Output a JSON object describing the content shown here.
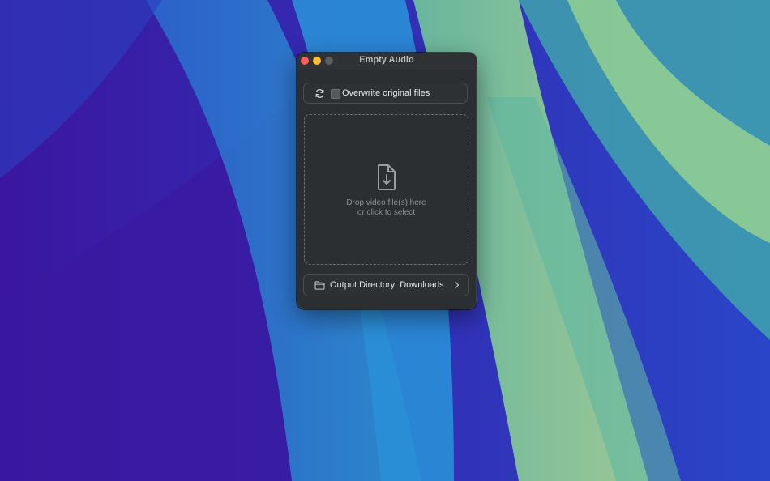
{
  "window": {
    "title": "Empty Audio"
  },
  "overwrite": {
    "label": "Overwrite original files",
    "checked": false,
    "icon": "refresh-icon"
  },
  "dropzone": {
    "line1": "Drop video file(s) here",
    "line2": "or click to select",
    "icon": "file-download-icon"
  },
  "output": {
    "label": "Output Directory: Downloads",
    "icon": "folder-icon",
    "chevron": "chevron-right-icon"
  },
  "colors": {
    "close": "#fe5f57",
    "minimize": "#febc2e",
    "window_bg": "#2b2f31"
  }
}
